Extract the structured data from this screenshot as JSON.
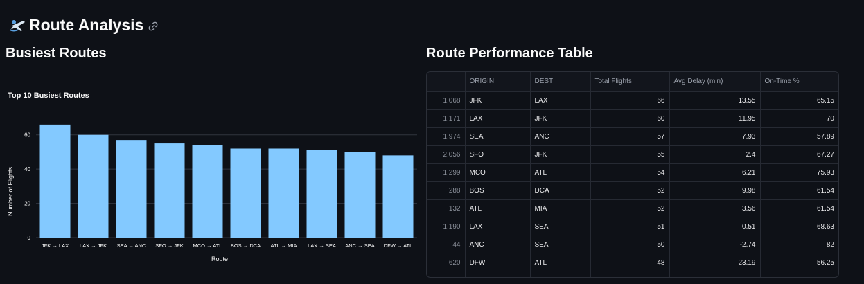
{
  "header": {
    "title": "Route Analysis",
    "icon": "airplane-icon",
    "link_icon": "link-icon"
  },
  "busiest": {
    "title": "Busiest Routes"
  },
  "performance": {
    "title": "Route Performance Table"
  },
  "chart_data": {
    "type": "bar",
    "title": "Top 10 Busiest Routes",
    "xlabel": "Route",
    "ylabel": "Number of Flights",
    "categories": [
      "JFK → LAX",
      "LAX → JFK",
      "SEA → ANC",
      "SFO → JFK",
      "MCO → ATL",
      "BOS → DCA",
      "ATL → MIA",
      "LAX → SEA",
      "ANC → SEA",
      "DFW → ATL"
    ],
    "values": [
      66,
      60,
      57,
      55,
      54,
      52,
      52,
      51,
      50,
      48
    ],
    "yticks": [
      0,
      20,
      40,
      60
    ],
    "ylim": [
      0,
      70
    ],
    "color": "#83c9ff",
    "grid": true
  },
  "table": {
    "columns": [
      "",
      "ORIGIN",
      "DEST",
      "Total Flights",
      "Avg Delay (min)",
      "On-Time %"
    ],
    "rows": [
      [
        "1,068",
        "JFK",
        "LAX",
        "66",
        "13.55",
        "65.15"
      ],
      [
        "1,171",
        "LAX",
        "JFK",
        "60",
        "11.95",
        "70"
      ],
      [
        "1,974",
        "SEA",
        "ANC",
        "57",
        "7.93",
        "57.89"
      ],
      [
        "2,056",
        "SFO",
        "JFK",
        "55",
        "2.4",
        "67.27"
      ],
      [
        "1,299",
        "MCO",
        "ATL",
        "54",
        "6.21",
        "75.93"
      ],
      [
        "288",
        "BOS",
        "DCA",
        "52",
        "9.98",
        "61.54"
      ],
      [
        "132",
        "ATL",
        "MIA",
        "52",
        "3.56",
        "61.54"
      ],
      [
        "1,190",
        "LAX",
        "SEA",
        "51",
        "0.51",
        "68.63"
      ],
      [
        "44",
        "ANC",
        "SEA",
        "50",
        "-2.74",
        "82"
      ],
      [
        "620",
        "DFW",
        "ATL",
        "48",
        "23.19",
        "56.25"
      ],
      [
        "",
        "",
        "",
        "",
        "",
        ""
      ]
    ]
  },
  "colors": {
    "background": "#0e1117",
    "bar": "#83c9ff",
    "text": "#fafafa",
    "muted": "#9aa0ab"
  }
}
